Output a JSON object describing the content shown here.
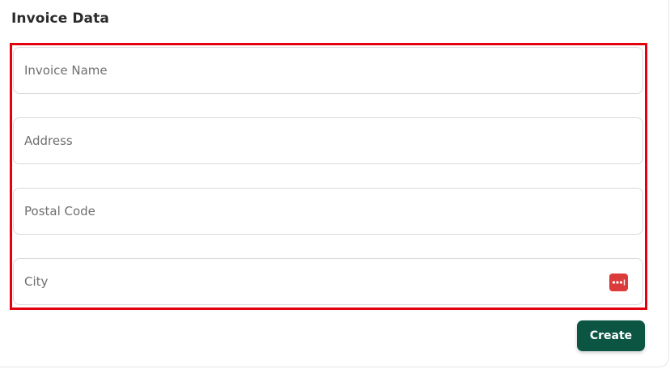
{
  "section": {
    "title": "Invoice Data"
  },
  "form": {
    "fields": [
      {
        "placeholder": "Invoice Name",
        "value": ""
      },
      {
        "placeholder": "Address",
        "value": ""
      },
      {
        "placeholder": "Postal Code",
        "value": ""
      },
      {
        "placeholder": "City",
        "value": ""
      }
    ],
    "city_autofill_icon": "password-manager-icon"
  },
  "actions": {
    "create_label": "Create"
  },
  "colors": {
    "accent": "#0b5542",
    "highlight": "#e3000f",
    "autofill_icon": "#dc3b3b"
  }
}
